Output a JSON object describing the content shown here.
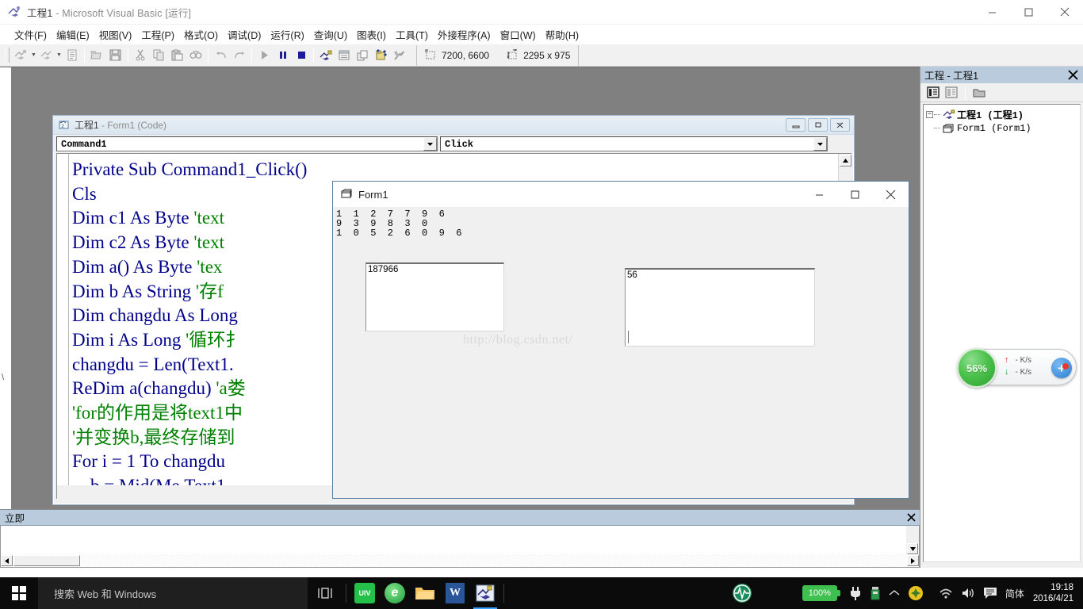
{
  "window": {
    "title_project": "工程1",
    "title_rest": " - Microsoft Visual Basic [运行]",
    "icon": "vb-app-icon",
    "buttons": {
      "minimize": "minimize-icon",
      "maximize": "maximize-icon",
      "close": "close-icon"
    }
  },
  "menubar": {
    "items": [
      {
        "label": "文件(F)"
      },
      {
        "label": "编辑(E)"
      },
      {
        "label": "视图(V)"
      },
      {
        "label": "工程(P)"
      },
      {
        "label": "格式(O)"
      },
      {
        "label": "调试(D)"
      },
      {
        "label": "运行(R)"
      },
      {
        "label": "查询(U)"
      },
      {
        "label": "图表(I)"
      },
      {
        "label": "工具(T)"
      },
      {
        "label": "外接程序(A)"
      },
      {
        "label": "窗口(W)"
      },
      {
        "label": "帮助(H)"
      }
    ]
  },
  "toolbar": {
    "buttons": [
      {
        "name": "add-project-icon"
      },
      {
        "name": "add-form-icon"
      },
      {
        "name": "menu-editor-icon"
      },
      {
        "name": "open-project-icon"
      },
      {
        "name": "save-project-icon"
      },
      {
        "name": "cut-icon"
      },
      {
        "name": "copy-icon"
      },
      {
        "name": "paste-icon"
      },
      {
        "name": "find-icon"
      },
      {
        "name": "undo-icon"
      },
      {
        "name": "redo-icon"
      },
      {
        "name": "start-icon"
      },
      {
        "name": "break-icon"
      },
      {
        "name": "end-icon"
      },
      {
        "name": "project-explorer-icon"
      },
      {
        "name": "properties-window-icon"
      },
      {
        "name": "form-layout-icon"
      },
      {
        "name": "object-browser-icon"
      },
      {
        "name": "toolbox-icon"
      }
    ],
    "position_label": "7200, 6600",
    "size_label": "2295 x 975",
    "position_icon": "position-icon",
    "size_icon": "size-icon"
  },
  "code_window": {
    "title_project": "工程1",
    "title_rest": " - Form1 (Code)",
    "object_combo": "Command1",
    "procedure_combo": "Click",
    "buttons": {
      "minimize": "minimize-icon",
      "restore": "restore-icon",
      "close": "close-icon"
    },
    "code_lines": [
      {
        "text": "Private Sub Command1_Click()",
        "comment": ""
      },
      {
        "text": "Cls",
        "comment": ""
      },
      {
        "text": "Dim c1 As Byte ",
        "comment": "'text"
      },
      {
        "text": "Dim c2 As Byte ",
        "comment": "'text"
      },
      {
        "text": "Dim a() As Byte ",
        "comment": "'tex"
      },
      {
        "text": "Dim b As String ",
        "comment": "'存f"
      },
      {
        "text": "Dim changdu As Long ",
        "comment": ""
      },
      {
        "text": "Dim i As Long ",
        "comment": "'循环扌"
      },
      {
        "text": "changdu = Len(Text1.",
        "comment": ""
      },
      {
        "text": "ReDim a(changdu) ",
        "comment": "'a娄"
      },
      {
        "text": "",
        "comment": "'for的作用是将text1中"
      },
      {
        "text": "",
        "comment": "'并变换b,最终存储到"
      },
      {
        "text": "For i = 1 To changdu",
        "comment": ""
      },
      {
        "text": "    b = Mid(Me.Text1",
        "comment": ""
      }
    ]
  },
  "form1": {
    "title": "Form1",
    "icon": "form-icon",
    "buttons": {
      "minimize": "minimize-icon",
      "maximize": "maximize-icon",
      "close": "close-icon"
    },
    "digit_grid": [
      "1  1  2  7  7  9  6",
      "9  3  9  8  3  0",
      "1  0  5  2  6  0  9  6"
    ],
    "textbox1_value": "187966",
    "textbox2_value": "56",
    "watermark": "http://blog.csdn.net/"
  },
  "immediate_window": {
    "title": "立即",
    "close": "close-icon",
    "content": ""
  },
  "project_explorer": {
    "title": "工程 - 工程1",
    "close": "close-icon",
    "toolbar": [
      {
        "name": "view-code-icon"
      },
      {
        "name": "view-object-icon"
      },
      {
        "name": "toggle-folders-icon"
      }
    ],
    "tree": {
      "root_label": "工程1 (工程1)",
      "root_icon": "project-icon",
      "expander": "−",
      "children": [
        {
          "label": "Form1 (Form1)",
          "icon": "form-node-icon"
        }
      ]
    }
  },
  "speed_widget": {
    "percent": "56%",
    "upload_rate": "- K/s",
    "download_rate": "- K/s",
    "upload_icon": "arrow-up-icon",
    "download_icon": "arrow-down-icon",
    "boost_icon": "plus-icon"
  },
  "taskbar": {
    "start_icon": "windows-start-icon",
    "search_placeholder": "搜索 Web 和 Windows",
    "task_view_icon": "task-view-icon",
    "apps": [
      {
        "name": "taskbar-app-green",
        "glyph": "UIV"
      },
      {
        "name": "taskbar-app-edge",
        "glyph": "e"
      },
      {
        "name": "taskbar-app-explorer",
        "glyph": ""
      },
      {
        "name": "taskbar-app-word",
        "glyph": "W"
      },
      {
        "name": "taskbar-app-vb",
        "glyph": ""
      }
    ],
    "tray_monitor_icon": "network-monitor-icon",
    "battery_label": "100%",
    "tray_icons": [
      {
        "name": "power-plug-icon"
      },
      {
        "name": "usb-icon"
      },
      {
        "name": "show-hidden-icons-icon"
      },
      {
        "name": "security-shield-icon"
      },
      {
        "name": "wifi-icon"
      },
      {
        "name": "volume-icon"
      },
      {
        "name": "action-center-icon"
      }
    ],
    "ime_label": "简体",
    "clock_time": "19:18",
    "clock_date": "2016/4/21"
  },
  "colors": {
    "accent_title": "#b9cbdc",
    "mdi_background": "#808080",
    "code_keyword": "#00008b",
    "code_comment": "#008000",
    "taskbar": "#0b0b0b"
  }
}
